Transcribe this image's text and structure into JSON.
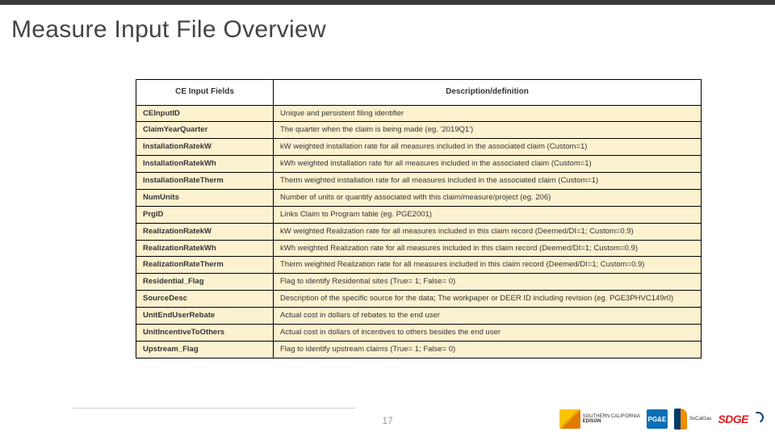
{
  "title": "Measure Input File Overview",
  "page_number": "17",
  "table": {
    "headers": [
      "CE Input Fields",
      "Description/definition"
    ],
    "rows": [
      {
        "field": "CEInputID",
        "desc": "Unique and persistent filing identifier"
      },
      {
        "field": "ClaimYearQuarter",
        "desc": "The quarter when the claim is being made (eg. '2019Q1')"
      },
      {
        "field": "InstallationRatekW",
        "desc": "kW weighted installation rate for all measures included in the associated claim (Custom=1)"
      },
      {
        "field": "InstallationRatekWh",
        "desc": "kWh weighted installation rate for all measures included in the associated claim (Custom=1)"
      },
      {
        "field": "InstallationRateTherm",
        "desc": "Therm weighted installation rate for all measures included in the associated claim (Custom=1)"
      },
      {
        "field": "NumUnits",
        "desc": "Number of units or quantity associated with this claim/measure/project (eg. 206)"
      },
      {
        "field": "PrgID",
        "desc": "Links Claim to Program table (eg. PGE2001)"
      },
      {
        "field": "RealizationRatekW",
        "desc": "kW weighted Realization rate for all measures included in this claim record (Deemed/DI=1; Custom=0.9)"
      },
      {
        "field": "RealizationRatekWh",
        "desc": "kWh weighted Realization rate for all measures included in this claim record (Deemed/DI=1; Custom=0.9)"
      },
      {
        "field": "RealizationRateTherm",
        "desc": "Therm weighted Realization rate for all measures included in this claim record (Deemed/DI=1; Custom=0.9)"
      },
      {
        "field": "Residential_Flag",
        "desc": "Flag to identify Residential sites (True= 1; False= 0)"
      },
      {
        "field": "SourceDesc",
        "desc": "Description of the specific source for the data; The workpaper or DEER ID including revision (eg. PGE3PHVC149r0)"
      },
      {
        "field": "UnitEndUserRebate",
        "desc": "Actual cost in dollars of rebates to the end user"
      },
      {
        "field": "UnitIncentiveToOthers",
        "desc": "Actual cost in dollars of incentives to others besides the end user"
      },
      {
        "field": "Upstream_Flag",
        "desc": "Flag to identify upstream claims (True= 1; False= 0)"
      }
    ]
  },
  "logos": {
    "sce": {
      "line1": "SOUTHERN CALIFORNIA",
      "line2": "EDISON"
    },
    "pge": {
      "mark": "PG&E"
    },
    "socalgas": {
      "line1": "SoCalGas",
      "line2": ""
    },
    "sdge": {
      "mark": "SDGE"
    }
  }
}
